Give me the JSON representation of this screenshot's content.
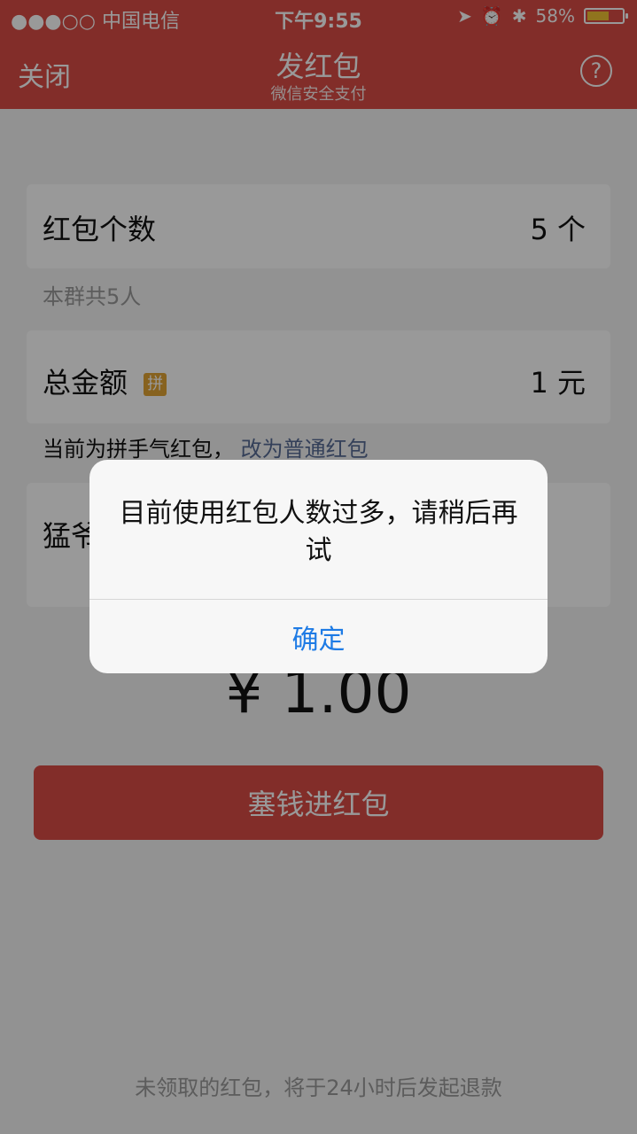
{
  "status": {
    "carrier": "●●●○○ 中国电信",
    "time": "下午9:55",
    "battery_percent": "58%"
  },
  "nav": {
    "close": "关闭",
    "title": "发红包",
    "subtitle": "微信安全支付",
    "help": "?"
  },
  "form": {
    "count_label": "红包个数",
    "count_value": "5  个",
    "group_hint": "本群共5人",
    "total_label": "总金额",
    "pin_badge": "拼",
    "total_value": "1  元",
    "current_mode": "当前为拼手气红包，",
    "switch_link": "改为普通红包",
    "greeting_prefix": "猛爷"
  },
  "amount_display": "¥ 1.00",
  "primary_button": "塞钱进红包",
  "footer_note": "未领取的红包，将于24小时后发起退款",
  "dialog": {
    "message": "目前使用红包人数过多，请稍后再试",
    "ok": "确定"
  },
  "colors": {
    "brand": "#d94b45",
    "link": "#576b95",
    "dialog_button": "#1e7be5"
  }
}
